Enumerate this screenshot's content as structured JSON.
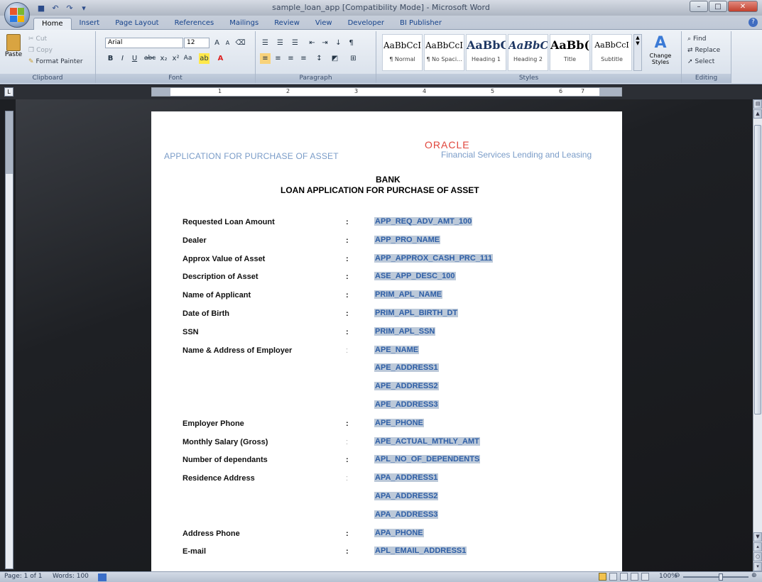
{
  "window": {
    "title": "sample_loan_app [Compatibility Mode] - Microsoft Word",
    "controls": {
      "minimize": "–",
      "maximize": "□",
      "close": "✕"
    }
  },
  "ribbon_tabs": [
    "Home",
    "Insert",
    "Page Layout",
    "References",
    "Mailings",
    "Review",
    "View",
    "Developer",
    "BI Publisher"
  ],
  "ribbon": {
    "clipboard": {
      "paste": "Paste",
      "cut": "Cut",
      "copy": "Copy",
      "format_painter": "Format Painter",
      "label": "Clipboard"
    },
    "font": {
      "name": "Arial",
      "size": "12",
      "label": "Font"
    },
    "paragraph": {
      "label": "Paragraph"
    },
    "styles": {
      "label": "Styles",
      "items": [
        {
          "sample": "AaBbCcI",
          "name": "¶ Normal"
        },
        {
          "sample": "AaBbCcI",
          "name": "¶ No Spaci..."
        },
        {
          "sample": "AaBbC(",
          "name": "Heading 1"
        },
        {
          "sample": "AaBbCc",
          "name": "Heading 2"
        },
        {
          "sample": "AaBb(",
          "name": "Title"
        },
        {
          "sample": "AaBbCcI",
          "name": "Subtitle"
        }
      ],
      "change_styles": "Change Styles"
    },
    "editing": {
      "find": "Find",
      "replace": "Replace",
      "select": "Select",
      "label": "Editing"
    }
  },
  "ruler": {
    "numbers": [
      "1",
      "2",
      "3",
      "4",
      "5",
      "6",
      "7"
    ]
  },
  "document": {
    "header_left": "APPLICATION FOR PURCHASE OF ASSET",
    "header_brand": "ORACLE",
    "header_right": "Financial Services Lending and Leasing",
    "title_line1": "BANK",
    "title_line2": "LOAN APPLICATION FOR PURCHASE OF ASSET",
    "fields": [
      {
        "label": "Requested  Loan Amount",
        "colon": ":",
        "value": "APP_REQ_ADV_AMT_100"
      },
      {
        "label": "Dealer",
        "colon": ":",
        "value": "APP_PRO_NAME"
      },
      {
        "label": "Approx Value of Asset",
        "colon": ":",
        "value": "APP_APPROX_CASH_PRC_111"
      },
      {
        "label": "Description of Asset",
        "colon": ":",
        "value": "ASE_APP_DESC_100"
      },
      {
        "label": "Name of Applicant",
        "colon": ":",
        "value": "PRIM_APL_NAME"
      },
      {
        "label": "Date of Birth",
        "colon": ":",
        "value": "PRIM_APL_BIRTH_DT"
      },
      {
        "label": "SSN",
        "colon": ":",
        "value": "PRIM_APL_SSN"
      },
      {
        "label": "Name & Address of Employer",
        "colon": ":",
        "value": "APE_NAME"
      },
      {
        "label": "",
        "colon": "",
        "value": "APE_ADDRESS1"
      },
      {
        "label": "",
        "colon": "",
        "value": "APE_ADDRESS2"
      },
      {
        "label": "",
        "colon": "",
        "value": "APE_ADDRESS3"
      },
      {
        "label": "Employer Phone",
        "colon": ":",
        "value": "APE_PHONE"
      },
      {
        "label": "Monthly Salary (Gross)",
        "colon": ":",
        "value": "APE_ACTUAL_MTHLY_AMT"
      },
      {
        "label": "Number of dependants",
        "colon": ":",
        "value": "APL_NO_OF_DEPENDENTS"
      },
      {
        "label": "Residence Address",
        "colon": ":",
        "value": "APA_ADDRESS1"
      },
      {
        "label": "",
        "colon": "",
        "value": "APA_ADDRESS2"
      },
      {
        "label": "",
        "colon": "",
        "value": "APA_ADDRESS3"
      },
      {
        "label": "Address Phone",
        "colon": ":",
        "value": "APA_PHONE"
      },
      {
        "label": "E-mail",
        "colon": ":",
        "value": "APL_EMAIL_ADDRESS1"
      }
    ]
  },
  "statusbar": {
    "page": "Page: 1 of 1",
    "words": "Words: 100",
    "zoom": "100%"
  }
}
